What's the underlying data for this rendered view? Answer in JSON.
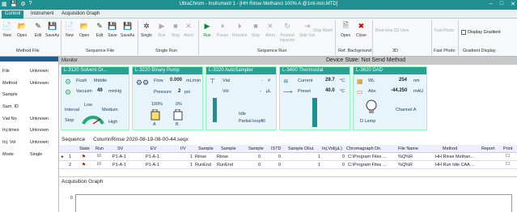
{
  "titlebar": {
    "title": "UltraChrom - Instrument 1 - [HH Rinse Methanol 100% A @1ml-min.MTD]",
    "icons": [
      "app-icon",
      "save-icon",
      "settings-icon",
      "help-icon"
    ]
  },
  "tabs": [
    {
      "label": "Control"
    },
    {
      "label": "Instrument"
    },
    {
      "label": "Acquisition Graph"
    }
  ],
  "ribbon": {
    "method_file": {
      "label": "Method File",
      "buttons": [
        "New",
        "Open",
        "Edit",
        "SaveAs"
      ]
    },
    "sequence_file": {
      "label": "Sequence File",
      "buttons": [
        "New",
        "Open",
        "Edit",
        "Save",
        "SaveAs"
      ]
    },
    "single_run": {
      "label": "Single Run",
      "buttons": [
        "Single",
        "Run",
        "Stop",
        "Abort"
      ]
    },
    "sequence_run": {
      "label": "Sequence Run",
      "buttons": [
        "Run",
        "Pause",
        "Resume",
        "Stop",
        "Abort",
        "Resend Injection",
        "Skip Vial",
        "Stop Wash"
      ]
    },
    "ref_bg": {
      "label": "Ref. Background",
      "buttons": [
        "Open",
        "Close"
      ]
    },
    "three_d": {
      "label": "3D",
      "buttons": [
        "Real-time 3D View"
      ]
    },
    "fast_photo": {
      "label": "Fast Photo",
      "buttons": [
        "Fast Photo"
      ]
    },
    "gradient_display": {
      "label": "Gradient Display",
      "checkbox": "Display Gradient"
    }
  },
  "left": {
    "header": "Monitor",
    "rows": [
      {
        "k": "File",
        "v": "Unknown"
      },
      {
        "k": "Method",
        "v": "Unknown"
      },
      {
        "k": "Sample",
        "v": ""
      },
      {
        "k": "Sam. ID",
        "v": ""
      },
      {
        "k": "Vial No",
        "v": "Unknown"
      },
      {
        "k": "Inj.times",
        "v": "Unknown"
      },
      {
        "k": "Inj. Vol",
        "v": "Unknown"
      },
      {
        "k": "Mode",
        "v": "Single"
      }
    ]
  },
  "monitor": {
    "header": "Monitor",
    "device_state": "Device State: Not Send Method",
    "solvent": {
      "title": "L-3120 Solvent Or...",
      "flush": "Flush",
      "flush_level": "Middle",
      "vacuum_label": "Vacuum",
      "vacuum": "49",
      "vacuum_unit": "mmHg",
      "interval": "Interval",
      "low": "Low",
      "medium": "Medium",
      "stop": "Stop",
      "high": "High"
    },
    "pump": {
      "title": "L-3220 Binary Pump",
      "flow_label": "Flow",
      "flow": "0.000",
      "flow_unit": "mL/min",
      "pressure_label": "Pressure",
      "pressure": "2",
      "pressure_unit": "psi",
      "pct_a": "100%",
      "pct_b": "0%",
      "a": "A",
      "b": "B"
    },
    "autosampler": {
      "title": "L-3320 AutoSampler",
      "vial": "Vial",
      "vial_val": "-",
      "vial_unit": "#",
      "vol": "Vol",
      "vol_val": "-",
      "vol_unit": "μL",
      "state1": "Idle",
      "state2": "Partial loopfill"
    },
    "thermostat": {
      "title": "L-3400 Thermostat",
      "current": "Current",
      "current_val": "29.7",
      "current_unit": "°C",
      "preset": "Preset",
      "preset_val": "40.0",
      "preset_unit": "°C"
    },
    "dad": {
      "title": "L-3620 DAD",
      "wl": "WL",
      "wl_val": "254",
      "wl_unit": "nm",
      "abs": "Abs",
      "abs_val": "-44.250",
      "abs_unit": "mAU",
      "lamp": "D Lamp",
      "channel": "Channel A"
    }
  },
  "sequence": {
    "label": "Sequence",
    "file": "ColumnRinse 2020-08-19-08-00-44.seqx",
    "columns": [
      "State",
      "Run",
      "SV",
      "EV",
      "I/V",
      "Sample",
      "Sample",
      "Sample",
      "ISTD",
      "Sample Dilut.",
      "Inj.Vol(μL)",
      "Chromagraph Dir.",
      "File Name",
      "Method",
      "Report",
      "Print"
    ],
    "rows": [
      {
        "n": "1",
        "sv": "P1-A-1",
        "ev": "P1-A-1",
        "iv": "1",
        "s1": "Rinse",
        "s2": "Rinse",
        "s3": "0",
        "istd": "0",
        "dil": "1",
        "vol": "0",
        "dir": "C:\\Program Files ...",
        "fn": "%Q%R",
        "method": "HH Rinse Methan..."
      },
      {
        "n": "2",
        "sv": "P1-A-1",
        "ev": "P1-A-1",
        "iv": "1",
        "s1": "RunEnd",
        "s2": "RunEnd",
        "s3": "0",
        "istd": "0",
        "dil": "1",
        "vol": "0",
        "dir": "C:\\Program Files ...",
        "fn": "%Q%R",
        "method": "HH Run Idle CAA ..."
      }
    ]
  },
  "acq": {
    "label": "Acquisition Graph",
    "y0": "0"
  },
  "colors": {
    "accent": "#1f8f8f",
    "module_header": "#2aa198"
  }
}
